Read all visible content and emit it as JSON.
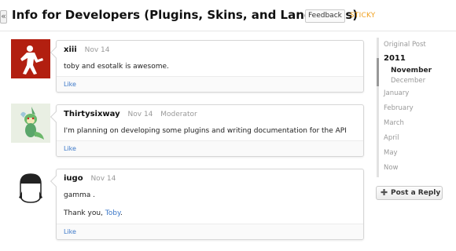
{
  "header": {
    "back_glyph": "«",
    "title": "Info for Developers (Plugins, Skins, and Languages)",
    "feedback_label": "Feedback",
    "sticky_label": "STICKY"
  },
  "posts": [
    {
      "author": "xiii",
      "date": "Nov 14",
      "role": "",
      "body": [
        "toby and esotalk is awesome."
      ],
      "like": "Like"
    },
    {
      "author": "Thirtysixway",
      "date": "Nov 14",
      "role": "Moderator",
      "body": [
        "I'm planning on developing some plugins and writing documentation for the API"
      ],
      "like": "Like"
    },
    {
      "author": "iugo",
      "date": "Nov 14",
      "role": "",
      "body_line1": "gamma .",
      "body_line2_prefix": "Thank you, ",
      "body_line2_mention": "Toby",
      "body_line2_suffix": ".",
      "like": "Like"
    }
  ],
  "timeline": {
    "original_post": "Original Post",
    "year": "2011",
    "active_month": "November",
    "months": [
      "December",
      "January",
      "February",
      "March",
      "April",
      "May",
      "Now"
    ]
  },
  "reply_button": {
    "icon": "plus-icon",
    "label": "Post a Reply"
  },
  "colors": {
    "accent_link": "#3c78c8",
    "sticky": "#f0a020",
    "avatar_red": "#b21f10"
  }
}
